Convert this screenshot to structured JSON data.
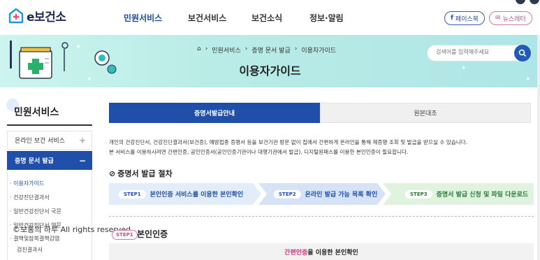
{
  "header": {
    "logo_text": "e보건소",
    "nav": [
      "민원서비스",
      "보건서비스",
      "보건소식",
      "정보·알림"
    ],
    "active_nav": "민원서비스",
    "facebook_label": "페이스북",
    "newsletter_label": "뉴스레터"
  },
  "banner": {
    "breadcrumb": [
      "민원서비스",
      "증명 문서 발급",
      "이용자가이드"
    ],
    "title": "이용자가이드",
    "search_placeholder": "검색어를 입력해주세요"
  },
  "sidebar": {
    "title": "민원서비스",
    "items": [
      {
        "label": "온라인 보건 서비스",
        "toggle": "+"
      },
      {
        "label": "증명 문서 발급",
        "toggle": "−"
      }
    ],
    "sub_items": [
      "이용자가이드",
      "건강진단결과서",
      "일반건강진단서 국문",
      "일반건강진단서 영문",
      "결핵및잠복결핵감염",
      "검진결과서"
    ]
  },
  "watermark": "©보롱의 하루 All rights reserved.",
  "tabs": [
    "증명서발급안내",
    "원본대조"
  ],
  "intro": [
    "개인의 건강진단서, 건강진단결과서(보건증), 예방접종 증명서 등을 보건기관 방문 없이 집에서 간편하게 온라인을 통해 제증명 조회 및 발급을 받으실 수 있습니다.",
    "본 서비스를 이용하시려면 간편인증, 공인인증서(공인인증기관이나 대행기관에서 발급), 디지털원패스를 이용한 본인인증이 필요합니다."
  ],
  "procedure": {
    "title": "증명서 발급 절차",
    "steps": [
      {
        "badge": "STEP1",
        "label": "본인인증 서비스를 이용한 본인확인"
      },
      {
        "badge": "STEP2",
        "label": "온라인 발급 가능 목록 확인"
      },
      {
        "badge": "STEP3",
        "label": "증명서 발급 신청 및 파일 다운로드"
      }
    ]
  },
  "step1": {
    "badge": "STEP1",
    "title": "본인인증",
    "auth_highlight": "간편인증",
    "auth_rest": "을 이용한 본인확인"
  },
  "colors": {
    "primary": "#1f4fa8",
    "banner": "#bfeee8",
    "highlight": "#ffe93a",
    "pink": "#d0347a"
  }
}
